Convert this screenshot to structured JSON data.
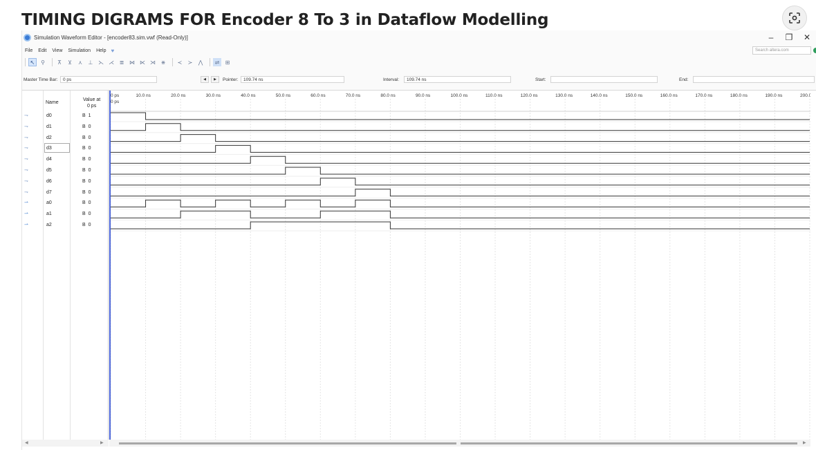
{
  "heading": "TIMING DIGRAMS FOR Encoder 8 To 3 in Dataflow Modelling",
  "lens_icon": "lens-icon",
  "window": {
    "title": "Simulation Waveform Editor - [encoder83.sim.vwf (Read-Only)]",
    "controls": [
      "–",
      "❐",
      "✕"
    ],
    "menu": [
      "File",
      "Edit",
      "View",
      "Simulation",
      "Help"
    ],
    "search_placeholder": "Search altera.com"
  },
  "toolbar": {
    "icons": [
      "pointer-tool",
      "zoom-tool",
      "forcing-low-tool",
      "forcing-high-tool",
      "clock-tool",
      "count-tool",
      "invert-tool",
      "random-tool",
      "overwrite-tool",
      "weak-low-tool",
      "weak-high-tool",
      "high-z-tool",
      "dont-care-tool",
      "snap-tool",
      "grid-tool",
      "reverse-tool",
      "functional-sim-tool",
      "timing-sim-tool"
    ]
  },
  "timebar": {
    "master_label": "Master Time Bar:",
    "master_value": "0 ps",
    "pointer_label": "Pointer:",
    "pointer_value": "109.74 ns",
    "interval_label": "Interval:",
    "interval_value": "109.74 ns",
    "start_label": "Start:",
    "start_value": "",
    "end_label": "End:",
    "end_value": ""
  },
  "columns": {
    "name": "Name",
    "value_line1": "Value at",
    "value_line2": "0 ps"
  },
  "time_ruler": {
    "ticks": [
      "0 ps",
      "10.0 ns",
      "20.0 ns",
      "30.0 ns",
      "40.0 ns",
      "50.0 ns",
      "60.0 ns",
      "70.0 ns",
      "80.0 ns",
      "90.0 ns",
      "100.0 ns",
      "110.0 ns",
      "120.0 ns",
      "130.0 ns",
      "140.0 ns",
      "150.0 ns",
      "160.0 ns",
      "170.0 ns",
      "180.0 ns",
      "190.0 ns",
      "200.0 ns"
    ],
    "cursor_label": "0 ps"
  },
  "signals": [
    {
      "name": "d0",
      "value": "B 1",
      "kind": "input",
      "segments": [
        [
          0,
          10,
          1
        ],
        [
          10,
          200,
          0
        ]
      ]
    },
    {
      "name": "d1",
      "value": "B 0",
      "kind": "input",
      "segments": [
        [
          0,
          10,
          0
        ],
        [
          10,
          20,
          1
        ],
        [
          20,
          200,
          0
        ]
      ]
    },
    {
      "name": "d2",
      "value": "B 0",
      "kind": "input",
      "segments": [
        [
          0,
          20,
          0
        ],
        [
          20,
          30,
          1
        ],
        [
          30,
          200,
          0
        ]
      ]
    },
    {
      "name": "d3",
      "value": "B 0",
      "kind": "input",
      "segments": [
        [
          0,
          30,
          0
        ],
        [
          30,
          40,
          1
        ],
        [
          40,
          200,
          0
        ]
      ]
    },
    {
      "name": "d4",
      "value": "B 0",
      "kind": "input",
      "segments": [
        [
          0,
          40,
          0
        ],
        [
          40,
          50,
          1
        ],
        [
          50,
          200,
          0
        ]
      ]
    },
    {
      "name": "d5",
      "value": "B 0",
      "kind": "input",
      "segments": [
        [
          0,
          50,
          0
        ],
        [
          50,
          60,
          1
        ],
        [
          60,
          200,
          0
        ]
      ]
    },
    {
      "name": "d6",
      "value": "B 0",
      "kind": "input",
      "segments": [
        [
          0,
          60,
          0
        ],
        [
          60,
          70,
          1
        ],
        [
          70,
          200,
          0
        ]
      ]
    },
    {
      "name": "d7",
      "value": "B 0",
      "kind": "input",
      "segments": [
        [
          0,
          70,
          0
        ],
        [
          70,
          80,
          1
        ],
        [
          80,
          200,
          0
        ]
      ]
    },
    {
      "name": "a0",
      "value": "B 0",
      "kind": "output",
      "segments": [
        [
          0,
          10,
          0
        ],
        [
          10,
          20,
          1
        ],
        [
          20,
          30,
          0
        ],
        [
          30,
          40,
          1
        ],
        [
          40,
          50,
          0
        ],
        [
          50,
          60,
          1
        ],
        [
          60,
          70,
          0
        ],
        [
          70,
          80,
          1
        ],
        [
          80,
          200,
          0
        ]
      ]
    },
    {
      "name": "a1",
      "value": "B 0",
      "kind": "output",
      "segments": [
        [
          0,
          20,
          0
        ],
        [
          20,
          40,
          1
        ],
        [
          40,
          60,
          0
        ],
        [
          60,
          80,
          1
        ],
        [
          80,
          200,
          0
        ]
      ]
    },
    {
      "name": "a2",
      "value": "B 0",
      "kind": "output",
      "segments": [
        [
          0,
          40,
          0
        ],
        [
          40,
          80,
          1
        ],
        [
          80,
          200,
          0
        ]
      ]
    }
  ],
  "colors": {
    "wave": "#333333",
    "grid": "#e4e4e4",
    "cursor": "#4a64d8",
    "accent": "#3a7bd5"
  }
}
